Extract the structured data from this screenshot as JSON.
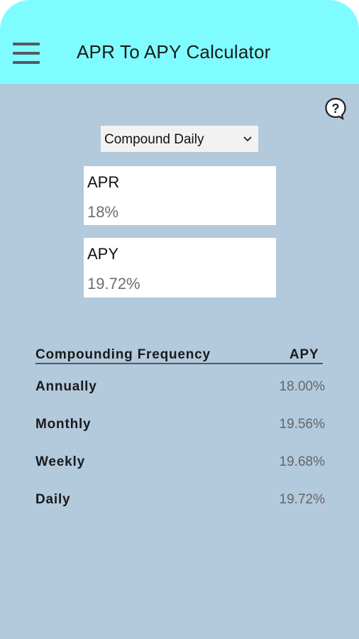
{
  "header": {
    "title": "APR To APY Calculator",
    "menu_icon": "hamburger-menu-icon",
    "background": "#7ffcff"
  },
  "help_icon": "help-question-icon",
  "compound_select": {
    "selected": "Compound Daily"
  },
  "apr_field": {
    "label": "APR",
    "value": "18%"
  },
  "apy_field": {
    "label": "APY",
    "value": "19.72%"
  },
  "table": {
    "header_frequency": "Compounding Frequency",
    "header_apy": "APY",
    "rows": [
      {
        "label": "Annually",
        "value": "18.00%"
      },
      {
        "label": "Monthly",
        "value": "19.56%"
      },
      {
        "label": "Weekly",
        "value": "19.68%"
      },
      {
        "label": "Daily",
        "value": "19.72%"
      }
    ]
  },
  "colors": {
    "body_background": "#b3c9dc",
    "header_background": "#7ffcff"
  }
}
